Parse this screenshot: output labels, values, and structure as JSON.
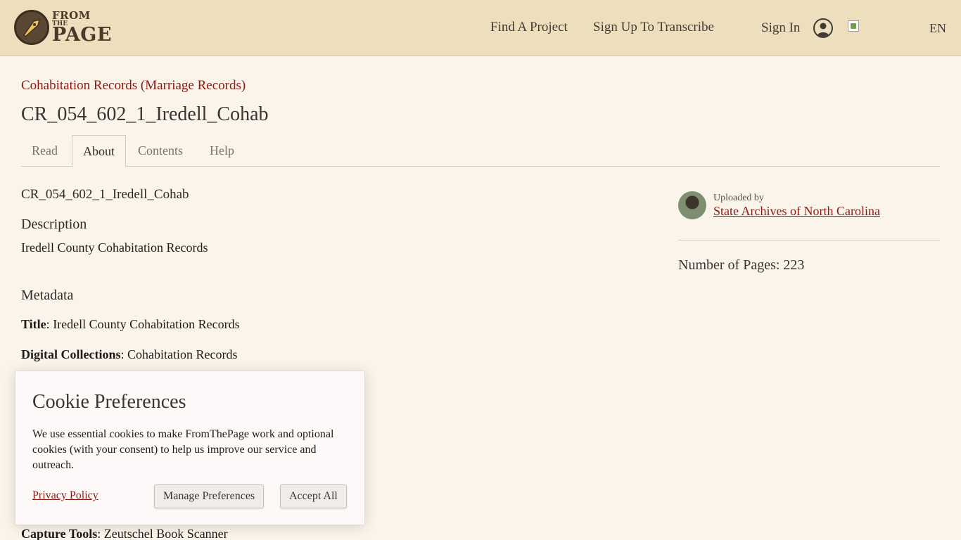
{
  "header": {
    "logo": {
      "from": "FROM",
      "the": "THE",
      "page": "PAGE"
    },
    "nav": {
      "find_project": "Find A Project",
      "sign_up": "Sign Up To Transcribe",
      "sign_in": "Sign In",
      "language": "EN"
    }
  },
  "breadcrumb": {
    "project": "Cohabitation Records (Marriage Records)"
  },
  "page_title": "CR_054_602_1_Iredell_Cohab",
  "tabs": [
    {
      "label": "Read",
      "active": false
    },
    {
      "label": "About",
      "active": true
    },
    {
      "label": "Contents",
      "active": false
    },
    {
      "label": "Help",
      "active": false
    }
  ],
  "main": {
    "doc_name": "CR_054_602_1_Iredell_Cohab",
    "description_heading": "Description",
    "description": "Iredell County Cohabitation Records",
    "metadata_heading": "Metadata",
    "metadata": [
      {
        "key": "Title",
        "value": "Iredell County Cohabitation Records"
      },
      {
        "key": "Digital Collections",
        "value": "Cohabitation Records"
      },
      {
        "key": "Capture Tools",
        "value": "Zeutschel Book Scanner"
      }
    ],
    "separator": ": "
  },
  "sidebar": {
    "uploaded_by_label": "Uploaded by",
    "uploader": "State Archives of North Carolina",
    "pages_label": "Number of Pages:",
    "pages_count": "223"
  },
  "cookie": {
    "title": "Cookie Preferences",
    "text": "We use essential cookies to make FromThePage work and optional cookies (with your consent) to help us improve our service and outreach.",
    "privacy_link": "Privacy Policy",
    "manage_button": "Manage Preferences",
    "accept_button": "Accept All"
  },
  "colors": {
    "header_bg": "#eddfbd",
    "page_bg": "#faf4ea",
    "link": "#8b1a12"
  },
  "icons": [
    "pen-nib-icon",
    "user-icon",
    "broken-image-icon"
  ]
}
